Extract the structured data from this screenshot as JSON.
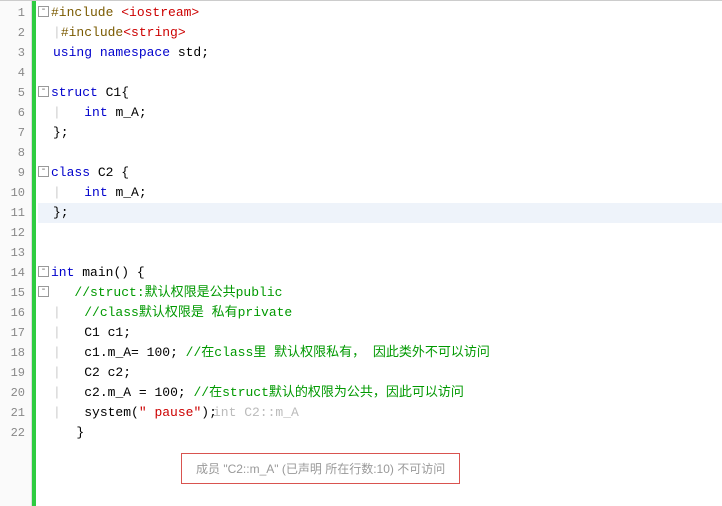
{
  "gutter": {
    "lines": [
      "1",
      "2",
      "3",
      "4",
      "5",
      "6",
      "7",
      "8",
      "9",
      "10",
      "11",
      "12",
      "13",
      "14",
      "15",
      "16",
      "17",
      "18",
      "19",
      "20",
      "21",
      "22"
    ]
  },
  "fold": {
    "minus": "-"
  },
  "code": {
    "l1": {
      "pp": "#include ",
      "hdr": "<iostream>"
    },
    "l2": {
      "pp": "#include",
      "hdr": "<string>"
    },
    "l3": {
      "kw1": "using ",
      "kw2": "namespace ",
      "id": "std",
      "end": ";"
    },
    "l5": {
      "kw": "struct ",
      "name": "C1",
      "brace": "{"
    },
    "l6": {
      "type": "int ",
      "id": "m_A",
      "end": ";"
    },
    "l7": {
      "close": "};"
    },
    "l9": {
      "kw": "class ",
      "name": "C2 ",
      "brace": "{"
    },
    "l10": {
      "type": "int ",
      "id": "m_A",
      "end": ";"
    },
    "l11": {
      "close": "};"
    },
    "l14": {
      "type": "int ",
      "fn": "main",
      "paren": "() {"
    },
    "l15": {
      "cmt": "//struct:默认权限是公共public"
    },
    "l16": {
      "cmt": "//class默认权限是 私有private"
    },
    "l17": {
      "type": "C1 ",
      "id": "c1",
      "end": ";"
    },
    "l18": {
      "id1": "c1",
      "dot": ".",
      "id2": "m_A",
      "eq": "= ",
      "num": "100",
      "semi": "; ",
      "cmt": "//在class里 默认权限私有， 因此类外不可以访问"
    },
    "l19": {
      "type": "C2 ",
      "id": "c2",
      "end": ";"
    },
    "l20": {
      "id1": "c2",
      "dot": ".",
      "id2": "m_A ",
      "eq": "= ",
      "num": "100",
      "semi": "; ",
      "cmt": "//在struct默认的权限为公共，因此可以访问"
    },
    "l21": {
      "fn": "system",
      "open": "(",
      "str": "\" pause\"",
      "close": ");",
      "hint": "int C2::m_A"
    },
    "l22": {
      "close": "}"
    }
  },
  "tooltip": {
    "text": "成员 \"C2::m_A\" (已声明 所在行数:10) 不可访问"
  },
  "chart_data": null
}
